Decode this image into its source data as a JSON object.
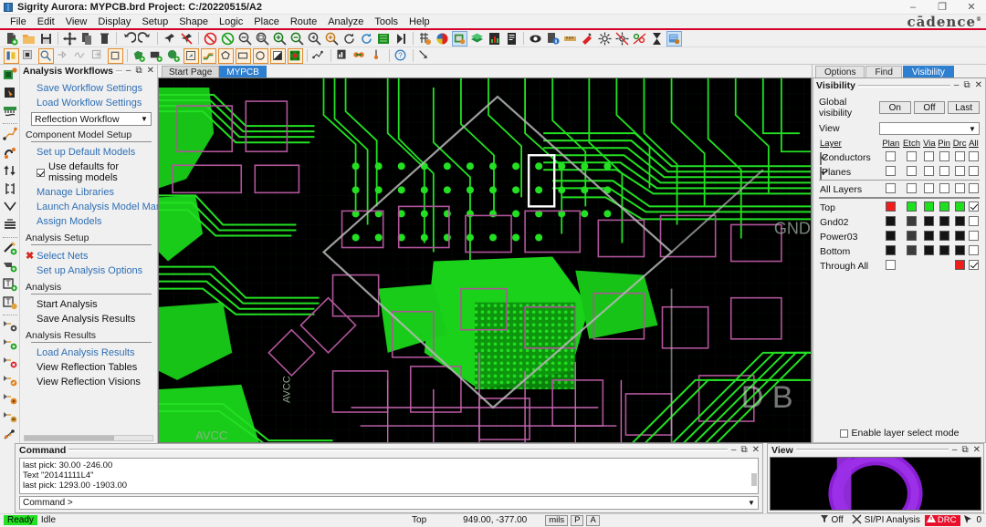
{
  "window": {
    "title": "Sigrity Aurora: MYPCB.brd  Project: C:/20220515/A2",
    "icon": "app-icon",
    "minimize": "–",
    "maximize": "❐",
    "close": "✕",
    "brand": "cādence",
    "brand_tm": "®"
  },
  "menu": {
    "items": [
      "File",
      "Edit",
      "View",
      "Display",
      "Setup",
      "Shape",
      "Logic",
      "Place",
      "Route",
      "Analyze",
      "Tools",
      "Help"
    ]
  },
  "tabs": {
    "items": [
      {
        "label": "Start Page",
        "active": false
      },
      {
        "label": "MYPCB",
        "active": true
      }
    ]
  },
  "workflows": {
    "title": "Analysis Workflows",
    "minimize": "–",
    "float": "⧉",
    "close": "✕",
    "save_settings": "Save Workflow Settings",
    "load_settings": "Load Workflow Settings",
    "workflow_selected": "Reflection Workflow",
    "sections": [
      {
        "heading": "Component Model Setup",
        "items": [
          {
            "label": "Set up Default Models",
            "type": "link"
          },
          {
            "label": "Use defaults for missing models",
            "type": "checkbox",
            "checked": true
          },
          {
            "label": "Manage Libraries",
            "type": "link"
          },
          {
            "label": "Launch Analysis Model Manager",
            "type": "link"
          },
          {
            "label": "Assign Models",
            "type": "link"
          }
        ]
      },
      {
        "heading": "Analysis Setup",
        "items": [
          {
            "label": "Select Nets",
            "type": "link-x"
          },
          {
            "label": "Set up Analysis Options",
            "type": "link"
          }
        ]
      },
      {
        "heading": "Analysis",
        "items": [
          {
            "label": "Start Analysis",
            "type": "plain"
          },
          {
            "label": "Save Analysis Results",
            "type": "plain"
          }
        ]
      },
      {
        "heading": "Analysis Results",
        "items": [
          {
            "label": "Load Analysis Results",
            "type": "link"
          },
          {
            "label": "View Reflection Tables",
            "type": "plain"
          },
          {
            "label": "View Reflection Visions",
            "type": "plain"
          }
        ]
      }
    ]
  },
  "right_panel": {
    "tabs": [
      {
        "label": "Options",
        "active": false
      },
      {
        "label": "Find",
        "active": false
      },
      {
        "label": "Visibility",
        "active": true
      }
    ],
    "visibility": {
      "title": "Visibility",
      "minimize": "–",
      "float": "⧉",
      "close": "✕",
      "global_label": "Global visibility",
      "global_buttons": [
        "On",
        "Off",
        "Last"
      ],
      "view_label": "View",
      "view_value": "",
      "columns": [
        "Layer",
        "Plan",
        "Etch",
        "Via",
        "Pin",
        "Drc",
        "All"
      ],
      "groups": [
        {
          "name": "Conductors",
          "checked": true,
          "cells": [
            "box",
            "box",
            "box",
            "box",
            "box",
            "box"
          ]
        },
        {
          "name": "Planes",
          "checked": true,
          "cells": [
            "box",
            "box",
            "box",
            "box",
            "box",
            "box"
          ]
        }
      ],
      "all_layers": {
        "name": "All Layers",
        "cells": [
          "box",
          "box",
          "box",
          "box",
          "box",
          "box"
        ]
      },
      "layers": [
        {
          "name": "Top",
          "cells": [
            "#ef1c1c",
            "#1fe01f",
            "#1fe01f",
            "#1fe01f",
            "#1fe01f"
          ],
          "all_checked": true
        },
        {
          "name": "Gnd02",
          "cells": [
            "#141414",
            "#3b3b3b",
            "#141414",
            "#141414",
            "#141414"
          ],
          "all_checked": false
        },
        {
          "name": "Power03",
          "cells": [
            "#141414",
            "#3b3b3b",
            "#141414",
            "#141414",
            "#141414"
          ],
          "all_checked": false
        },
        {
          "name": "Bottom",
          "cells": [
            "#141414",
            "#3b3b3b",
            "#141414",
            "#141414",
            "#141414"
          ],
          "all_checked": false
        },
        {
          "name": "Through All",
          "cells": [
            "white",
            "",
            "",
            "",
            "#ef1c1c"
          ],
          "all_checked": true
        }
      ],
      "enable_layer_select": "Enable layer select mode",
      "enable_layer_select_checked": false
    }
  },
  "command_panel": {
    "title": "Command",
    "minimize": "–",
    "float": "⧉",
    "close": "✕",
    "log_lines": [
      "last pick:  30.00  -246.00",
      "Text \"20141111L4\"",
      "last pick:  1293.00  -1903.00"
    ],
    "prompt": "Command >"
  },
  "view_panel": {
    "title": "View",
    "minimize": "–",
    "float": "⧉",
    "close": "✕"
  },
  "status_bar": {
    "ready": "Ready",
    "idle": "Idle",
    "layer": "Top",
    "coords": "949.00, -377.00",
    "units": "mils",
    "pick_mode": "P",
    "alt_mode": "A",
    "filter": "Off",
    "analysis": "SI/PI Analysis",
    "drc": "DRC",
    "drc_count": "0"
  },
  "canvas": {
    "net_labels": [
      "GND",
      "AVCC",
      "VCC",
      "B"
    ],
    "background": "#000000",
    "trace_color": "#1fe01f",
    "outline_color": "#b0559a",
    "highlight_color": "#ffffff"
  },
  "toolbar_row1": {
    "icons": [
      "new-file-icon",
      "open-folder-icon",
      "save-icon",
      "move-icon",
      "copy-icon",
      "delete-icon",
      "undo-icon",
      "redo-icon",
      "pin-icon",
      "unpin-icon",
      "drc-on-icon",
      "drc-off-icon",
      "zoom-fit-icon",
      "zoom-window-icon",
      "zoom-in-icon",
      "zoom-out-icon",
      "zoom-prev-icon",
      "zoom-center-icon",
      "zoom-refresh-icon",
      "redraw-icon",
      "board-icon",
      "step-icon",
      "grid-icon",
      "color-icon",
      "layer-icon",
      "stackup-icon",
      "report-icon",
      "doc-icon",
      "visibility-icon",
      "info-icon",
      "measure-icon",
      "palette-icon",
      "light-icon",
      "lightoff-icon",
      "net-icon",
      "wait-icon",
      "constraint-icon"
    ]
  },
  "toolbar_row2": {
    "icons": [
      "dehighlight-icon",
      "component-icon",
      "select-icon",
      "pin-tool-icon",
      "wave-icon",
      "extract-icon",
      "square-icon",
      "shape-add-icon",
      "plane-add-icon",
      "circle-add-icon",
      "region-icon",
      "route-icon",
      "polygon-icon",
      "rect-icon",
      "ellipse-icon",
      "gradient-icon",
      "via-matrix-icon",
      "path-icon",
      "report2-icon",
      "bga-icon",
      "swap-icon",
      "pin-drop-icon",
      "help-icon",
      "arrow-icon"
    ]
  }
}
